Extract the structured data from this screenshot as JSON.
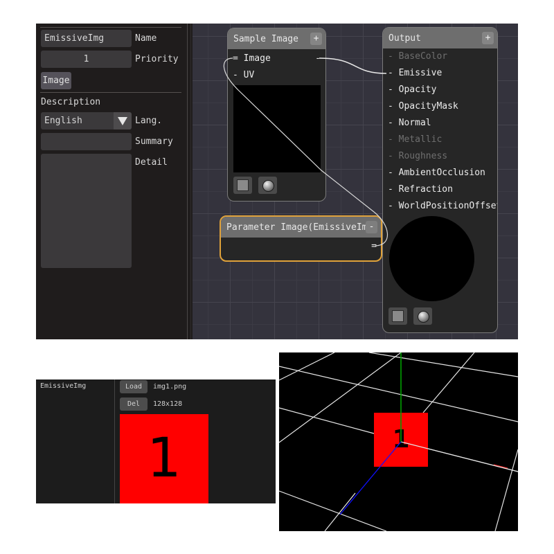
{
  "properties": {
    "name_value": "EmissiveImg",
    "name_label": "Name",
    "priority_value": "1",
    "priority_label": "Priority",
    "type_button": "Image",
    "description_heading": "Description",
    "language_value": "English",
    "language_label": "Lang.",
    "summary_value": "",
    "summary_label": "Summary",
    "detail_value": "",
    "detail_label": "Detail"
  },
  "nodes": {
    "sample_image": {
      "title": "Sample Image",
      "add_button": "+",
      "inputs": [
        {
          "label": "= Image",
          "enabled": true
        },
        {
          "label": "- UV",
          "enabled": true
        }
      ],
      "output_marker": "-"
    },
    "output": {
      "title": "Output",
      "add_button": "+",
      "inputs": [
        {
          "label": "- BaseColor",
          "enabled": false
        },
        {
          "label": "- Emissive",
          "enabled": true
        },
        {
          "label": "- Opacity",
          "enabled": true
        },
        {
          "label": "- OpacityMask",
          "enabled": true
        },
        {
          "label": "- Normal",
          "enabled": true
        },
        {
          "label": "- Metallic",
          "enabled": false
        },
        {
          "label": "- Roughness",
          "enabled": false
        },
        {
          "label": "- AmbientOcclusion",
          "enabled": true
        },
        {
          "label": "- Refraction",
          "enabled": true
        },
        {
          "label": "- WorldPositionOffset",
          "enabled": true
        }
      ]
    },
    "parameter": {
      "title": "Parameter Image(EmissiveImg)",
      "remove_button": "-",
      "output_marker": "="
    }
  },
  "image_panel": {
    "param_name": "EmissiveImg",
    "load_button": "Load",
    "delete_button": "Del",
    "file_name": "img1.png",
    "image_size": "128x128",
    "texture_glyph": "1"
  },
  "viewport": {
    "texture_glyph": "1"
  },
  "colors": {
    "accent_selected": "#e0a23a",
    "texture_red": "#ff0000",
    "axis_y": "#00a000",
    "axis_z": "#0000ff"
  }
}
